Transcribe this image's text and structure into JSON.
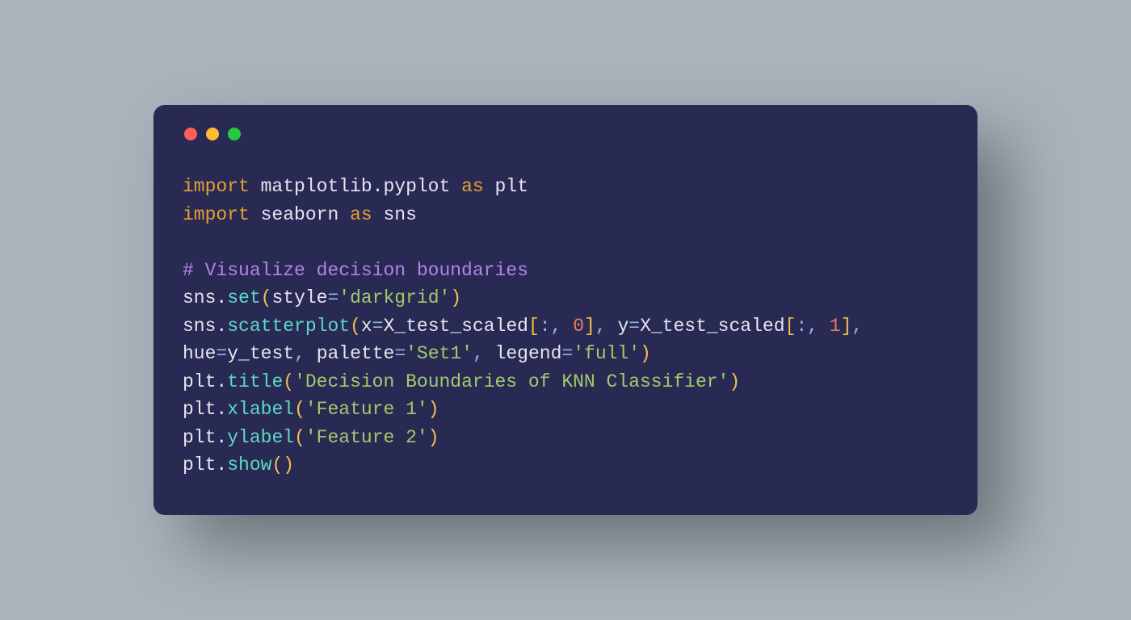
{
  "traffic": {
    "red": "#FF5F56",
    "yellow": "#FFBD2E",
    "green": "#27C93F"
  },
  "colors": {
    "bg_page": "#AAB2BC",
    "bg_card": "#292A54",
    "keyword": "#E5A034",
    "comment": "#B383E8",
    "call": "#5DD9C3",
    "paren": "#F2C14E",
    "string": "#9FCB6B",
    "number": "#F07B5E",
    "operator": "#8FB8E5",
    "plain": "#E4E6EF"
  },
  "code": {
    "l1": {
      "import": "import",
      "a": " matplotlib",
      "dot": ".",
      "b": "pyplot ",
      "as": "as",
      "c": " plt"
    },
    "l2": {
      "import": "import",
      "a": " seaborn ",
      "as": "as",
      "c": " sns"
    },
    "l3": {
      "comment": "# Visualize decision boundaries"
    },
    "l4": {
      "a": "sns",
      "dot": ".",
      "fn": "set",
      "lp": "(",
      "k1": "style",
      "eq": "=",
      "s1": "'darkgrid'",
      "rp": ")"
    },
    "l5": {
      "a": "sns",
      "dot": ".",
      "fn": "scatterplot",
      "lp": "(",
      "k1": "x",
      "eq1": "=",
      "v1": "X_test_scaled",
      "lb1": "[",
      "colon1": ":",
      "comma1": ",",
      "sp1": " ",
      "n1": "0",
      "rb1": "]",
      "comma2": ",",
      "sp2": " ",
      "k2": "y",
      "eq2": "=",
      "v2": "X_test_scaled",
      "lb2": "[",
      "colon2": ":",
      "comma3": ",",
      "sp3": " ",
      "n2": "1",
      "rb2": "]",
      "comma4": ","
    },
    "l6": {
      "k1": "hue",
      "eq1": "=",
      "v1": "y_test",
      "comma1": ",",
      "sp1": " ",
      "k2": "palette",
      "eq2": "=",
      "s1": "'Set1'",
      "comma2": ",",
      "sp2": " ",
      "k3": "legend",
      "eq3": "=",
      "s2": "'full'",
      "rp": ")"
    },
    "l7": {
      "a": "plt",
      "dot": ".",
      "fn": "title",
      "lp": "(",
      "s": "'Decision Boundaries of KNN Classifier'",
      "rp": ")"
    },
    "l8": {
      "a": "plt",
      "dot": ".",
      "fn": "xlabel",
      "lp": "(",
      "s": "'Feature 1'",
      "rp": ")"
    },
    "l9": {
      "a": "plt",
      "dot": ".",
      "fn": "ylabel",
      "lp": "(",
      "s": "'Feature 2'",
      "rp": ")"
    },
    "l10": {
      "a": "plt",
      "dot": ".",
      "fn": "show",
      "lp": "(",
      "rp": ")"
    }
  }
}
